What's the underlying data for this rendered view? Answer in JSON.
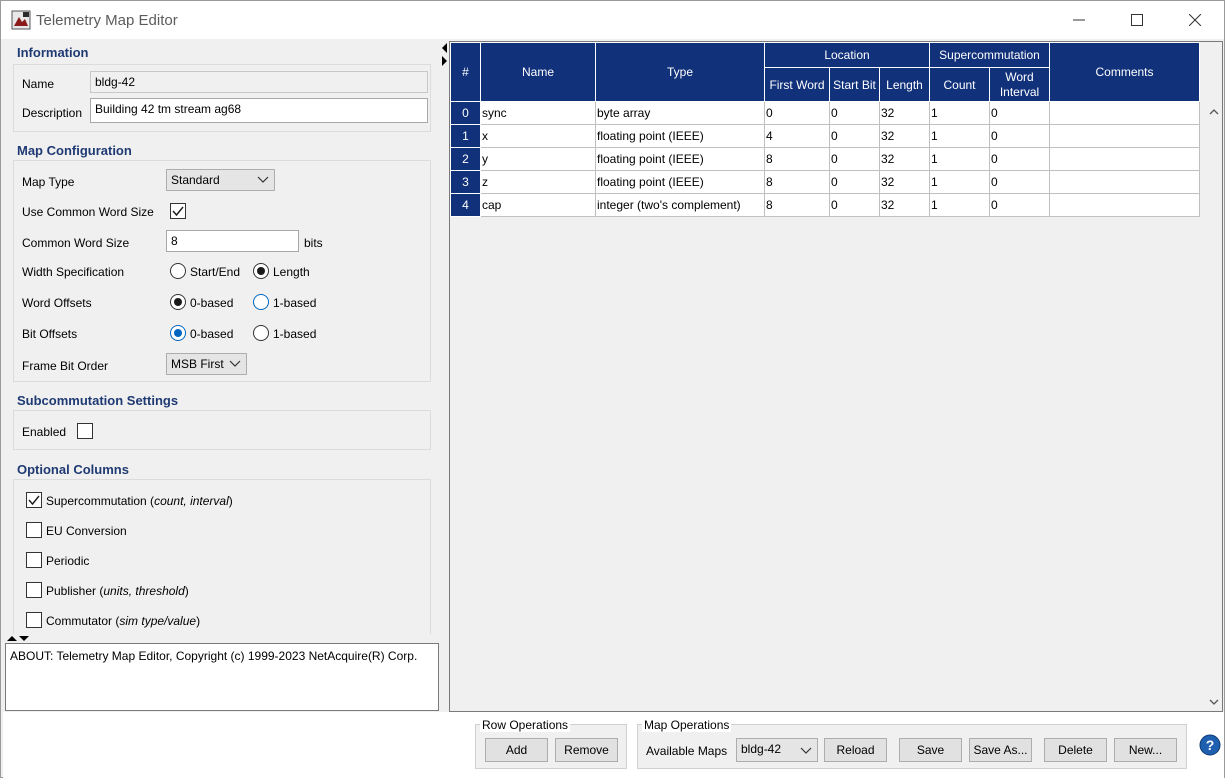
{
  "window": {
    "title": "Telemetry Map Editor"
  },
  "information": {
    "section_title": "Information",
    "name_label": "Name",
    "name_value": "bldg-42",
    "description_label": "Description",
    "description_value": "Building 42 tm stream ag68"
  },
  "map_config": {
    "section_title": "Map Configuration",
    "map_type_label": "Map Type",
    "map_type_value": "Standard",
    "use_common_label": "Use Common Word Size",
    "use_common_checked": true,
    "common_size_label": "Common Word Size",
    "common_size_value": "8",
    "common_size_unit": "bits",
    "width_spec_label": "Width Specification",
    "width_spec_opt1": "Start/End",
    "width_spec_opt2": "Length",
    "width_spec_selected": "Length",
    "word_offsets_label": "Word Offsets",
    "word_offsets_opt1": "0-based",
    "word_offsets_opt2": "1-based",
    "word_offsets_selected": "0-based",
    "bit_offsets_label": "Bit Offsets",
    "bit_offsets_opt1": "0-based",
    "bit_offsets_opt2": "1-based",
    "bit_offsets_selected": "0-based",
    "frame_bit_order_label": "Frame Bit Order",
    "frame_bit_order_value": "MSB First"
  },
  "subcommutation": {
    "section_title": "Subcommutation Settings",
    "enabled_label": "Enabled",
    "enabled_checked": false
  },
  "optional_columns": {
    "section_title": "Optional Columns",
    "items": [
      {
        "label": "Supercommutation",
        "hint": "count, interval",
        "checked": true
      },
      {
        "label": "EU Conversion",
        "hint": "",
        "checked": false
      },
      {
        "label": "Periodic",
        "hint": "",
        "checked": false
      },
      {
        "label": "Publisher",
        "hint": "units, threshold",
        "checked": false
      },
      {
        "label": "Commutator",
        "hint": "sim type/value",
        "checked": false
      }
    ]
  },
  "about": {
    "text": "ABOUT: Telemetry Map Editor, Copyright (c) 1999-2023 NetAcquire(R) Corp."
  },
  "table": {
    "headers": {
      "index": "#",
      "name": "Name",
      "type": "Type",
      "location": "Location",
      "first_word": "First Word",
      "start_bit": "Start Bit",
      "length": "Length",
      "supercommutation": "Supercommutation",
      "count": "Count",
      "word_interval": "Word Interval",
      "comments": "Comments"
    },
    "rows": [
      {
        "index": "0",
        "name": "sync",
        "type": "byte array",
        "first_word": "0",
        "start_bit": "0",
        "length": "32",
        "count": "1",
        "word_interval": "0",
        "comments": ""
      },
      {
        "index": "1",
        "name": "x",
        "type": "floating point (IEEE)",
        "first_word": "4",
        "start_bit": "0",
        "length": "32",
        "count": "1",
        "word_interval": "0",
        "comments": ""
      },
      {
        "index": "2",
        "name": "y",
        "type": "floating point (IEEE)",
        "first_word": "8",
        "start_bit": "0",
        "length": "32",
        "count": "1",
        "word_interval": "0",
        "comments": ""
      },
      {
        "index": "3",
        "name": "z",
        "type": "floating point (IEEE)",
        "first_word": "8",
        "start_bit": "0",
        "length": "32",
        "count": "1",
        "word_interval": "0",
        "comments": ""
      },
      {
        "index": "4",
        "name": "cap",
        "type": "integer (two's complement)",
        "first_word": "8",
        "start_bit": "0",
        "length": "32",
        "count": "1",
        "word_interval": "0",
        "comments": ""
      }
    ]
  },
  "row_operations": {
    "title": "Row Operations",
    "add": "Add",
    "remove": "Remove"
  },
  "map_operations": {
    "title": "Map Operations",
    "available_maps_label": "Available Maps",
    "available_maps_value": "bldg-42",
    "reload": "Reload",
    "save": "Save",
    "save_as": "Save As...",
    "delete": "Delete",
    "new": "New..."
  },
  "colors": {
    "header_blue": "#11317a",
    "section_title": "#1f3a73",
    "radio_accent": "#0067c0"
  }
}
